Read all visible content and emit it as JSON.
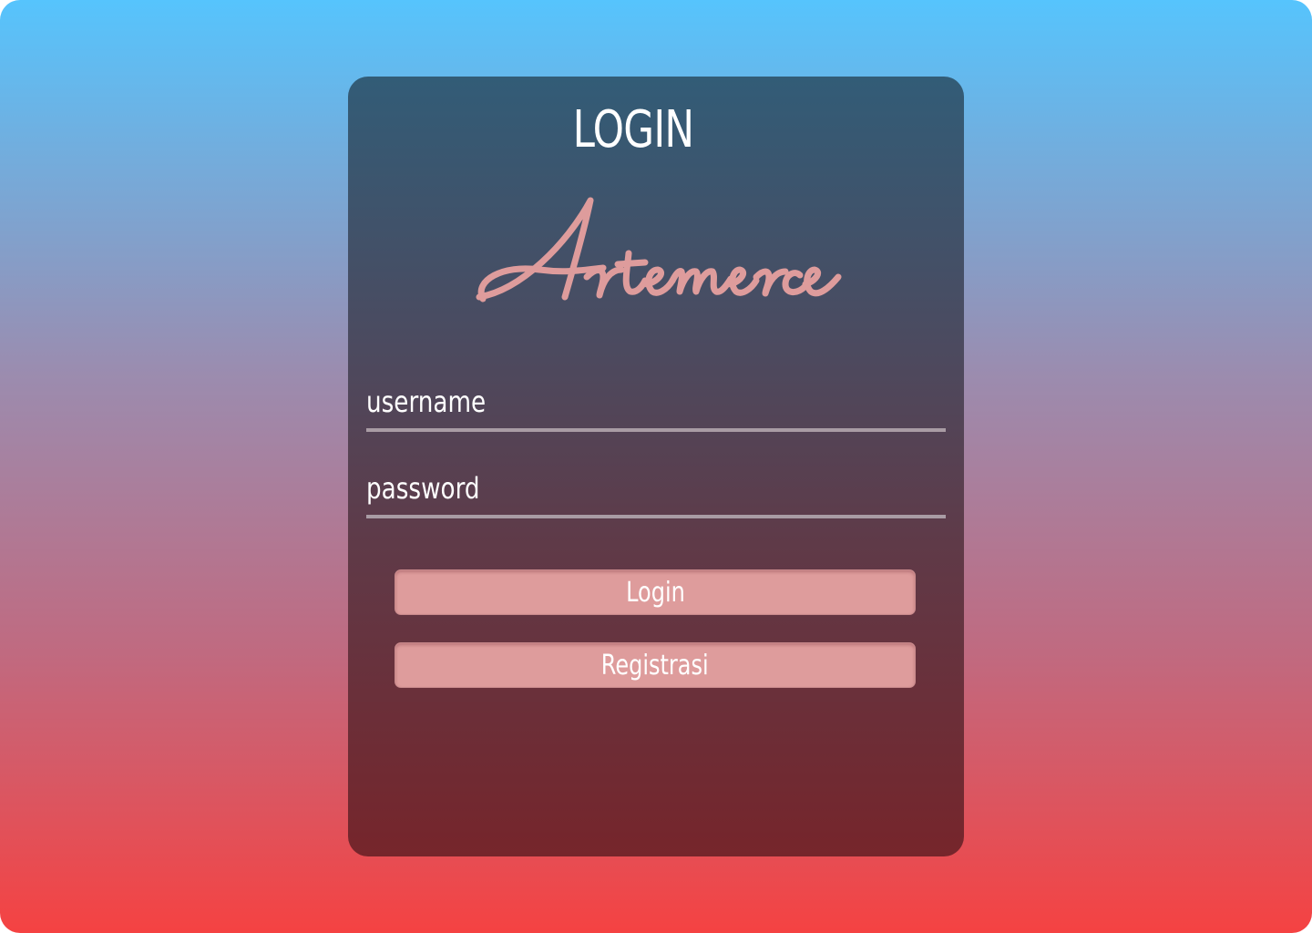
{
  "page": {
    "title": "LOGIN",
    "brand": "Artemerce"
  },
  "form": {
    "username_label": "username",
    "password_label": "password",
    "login_button": "Login",
    "register_button": "Registrasi"
  },
  "colors": {
    "background_top": "#56c4fd",
    "background_bottom": "#f54242",
    "card_top": "#325c77",
    "card_bottom": "#76252b",
    "brand_pink": "#de9c9c",
    "field_underline": "#a99ca4",
    "text": "#ffffff"
  }
}
